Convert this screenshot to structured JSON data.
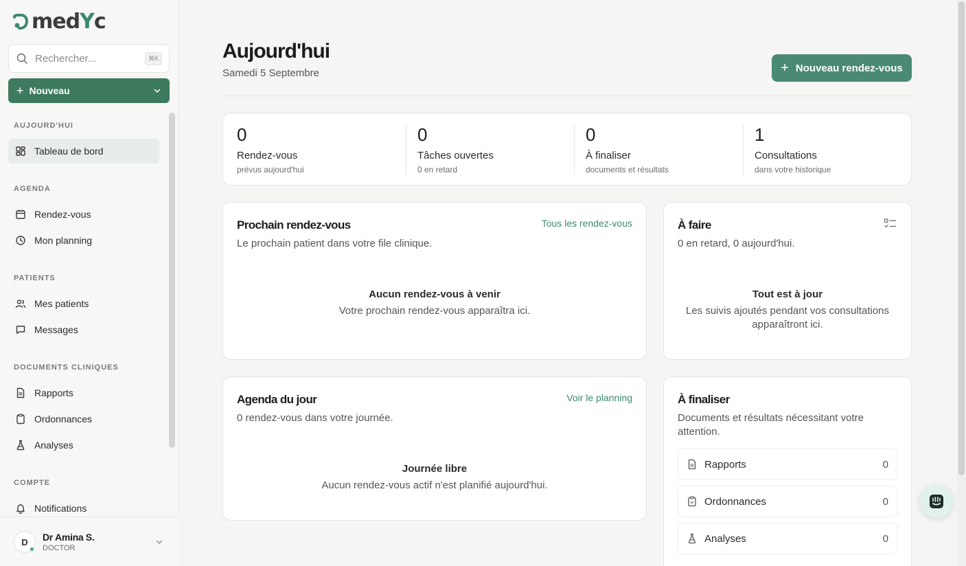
{
  "brand": {
    "logo_text_start": "med",
    "logo_text_end": "c"
  },
  "search": {
    "placeholder": "Rechercher...",
    "shortcut": "⌘K"
  },
  "sidebar": {
    "new_label": "Nouveau",
    "sections": {
      "today": "AUJOURD'HUI",
      "agenda": "AGENDA",
      "patients": "PATIENTS",
      "documents": "DOCUMENTS CLINIQUES",
      "account": "COMPTE"
    },
    "items": {
      "dashboard": "Tableau de bord",
      "appointments": "Rendez-vous",
      "planning": "Mon planning",
      "my_patients": "Mes patients",
      "messages": "Messages",
      "reports": "Rapports",
      "prescriptions": "Ordonnances",
      "analyses": "Analyses",
      "notifications": "Notifications"
    }
  },
  "user": {
    "initial": "D",
    "name": "Dr Amina S.",
    "role": "DOCTOR"
  },
  "header": {
    "title": "Aujourd'hui",
    "date": "Samedi 5 Septembre",
    "new_appointment": "Nouveau rendez-vous"
  },
  "stats": [
    {
      "value": "0",
      "label": "Rendez-vous",
      "sub": "prévus aujourd'hui"
    },
    {
      "value": "0",
      "label": "Tâches ouvertes",
      "sub": "0 en retard"
    },
    {
      "value": "0",
      "label": "À finaliser",
      "sub": "documents et résultats"
    },
    {
      "value": "1",
      "label": "Consultations",
      "sub": "dans votre historique"
    }
  ],
  "next_appointment": {
    "title": "Prochain rendez-vous",
    "subtitle": "Le prochain patient dans votre file clinique.",
    "link": "Tous les rendez-vous",
    "empty_title": "Aucun rendez-vous à venir",
    "empty_sub": "Votre prochain rendez-vous apparaîtra ici."
  },
  "todo": {
    "title": "À faire",
    "subtitle": "0 en retard, 0 aujourd'hui.",
    "empty_title": "Tout est à jour",
    "empty_sub": "Les suivis ajoutés pendant vos consultations apparaîtront ici."
  },
  "agenda": {
    "title": "Agenda du jour",
    "subtitle": "0 rendez-vous dans votre journée.",
    "link": "Voir le planning",
    "empty_title": "Journée libre",
    "empty_sub": "Aucun rendez-vous actif n'est planifié aujourd'hui."
  },
  "to_finalize": {
    "title": "À finaliser",
    "subtitle": "Documents et résultats nécessitant votre attention.",
    "rows": [
      {
        "name": "Rapports",
        "count": "0"
      },
      {
        "name": "Ordonnances",
        "count": "0"
      },
      {
        "name": "Analyses",
        "count": "0"
      }
    ]
  },
  "colors": {
    "accent": "#3d7a5e",
    "link": "#3d8a6c",
    "primary_button": "#4a8a75"
  }
}
